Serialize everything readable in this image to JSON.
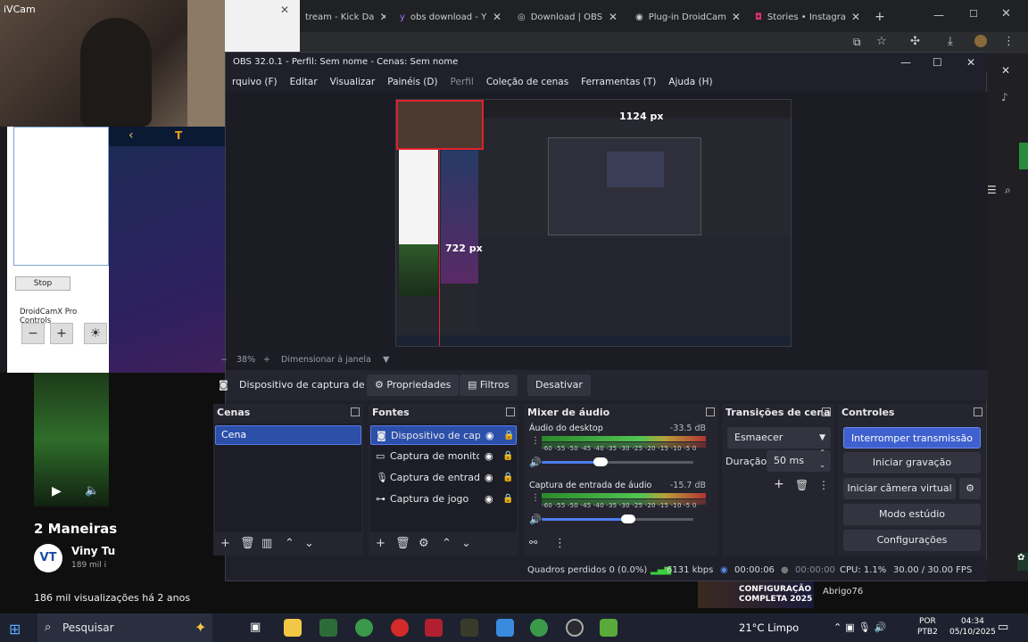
{
  "webcam": {
    "title": "iVCam"
  },
  "browser": {
    "tabs": [
      {
        "label": "tream - Kick Da"
      },
      {
        "label": "obs download - Y"
      },
      {
        "label": "Download | OBS"
      },
      {
        "label": "Plug-in DroidCam"
      },
      {
        "label": "Stories • Instagra"
      }
    ],
    "new_tab": "+"
  },
  "droidcam": {
    "stop_label": "Stop",
    "controls_label": "DroidCamX Pro Controls"
  },
  "youtube": {
    "video_title": "2 Maneiras",
    "channel": "Viny Tu",
    "avatar_text": "VT",
    "subs": "189 mil i",
    "views": "186 mil visualizações há 2 anos",
    "comment_author": "Abrigo76",
    "promo": "CONFIGURAÇÃO COMPLETA 2025"
  },
  "obs": {
    "title": "OBS 32.0.1 - Perfil: Sem nome - Cenas: Sem nome",
    "menu": [
      "rquivo (F)",
      "Editar",
      "Visualizar",
      "Painéis (D)",
      "Perfil",
      "Coleção de cenas",
      "Ferramentas (T)",
      "Ajuda (H)"
    ],
    "preview": {
      "width_label": "1124 px",
      "height_label": "722 px"
    },
    "zoom": {
      "minus": "−",
      "value": "38%",
      "plus": "+",
      "fit": "Dimensionar à janela"
    },
    "source_toolbar": {
      "source_name": "Dispositivo de captura de v",
      "properties": "Propriedades",
      "filters": "Filtros",
      "deactivate": "Desativar"
    },
    "scenes": {
      "title": "Cenas",
      "items": [
        "Cena"
      ]
    },
    "sources": {
      "title": "Fontes",
      "items": [
        {
          "label": "Dispositivo de captu",
          "icon": "camera-icon"
        },
        {
          "label": "Captura de monitor",
          "icon": "monitor-icon"
        },
        {
          "label": "Captura de entrada",
          "icon": "microphone-icon"
        },
        {
          "label": "Captura de jogo",
          "icon": "gamepad-icon"
        }
      ]
    },
    "mixer": {
      "title": "Mixer de áudio",
      "channels": [
        {
          "name": "Áudio do desktop",
          "db": "-33.5 dB",
          "volume": 0.39
        },
        {
          "name": "Captura de entrada de áudio",
          "db": "-15.7 dB",
          "volume": 0.57
        }
      ],
      "scale": "-60 -55 -50 -45 -40 -35 -30 -25 -20 -15 -10 -5 0"
    },
    "transitions": {
      "title": "Transições de cena",
      "selected": "Esmaecer",
      "duration_label": "Duração",
      "duration_value": "50 ms"
    },
    "controls": {
      "title": "Controles",
      "buttons": [
        "Interromper transmissão",
        "Iniciar gravação",
        "Iniciar câmera virtual",
        "Modo estúdio",
        "Configurações"
      ]
    },
    "status": {
      "dropped": "Quadros perdidos 0 (0.0%)",
      "bitrate": "6131 kbps",
      "stream_time": "00:00:06",
      "rec_time": "00:00:00",
      "cpu": "CPU: 1.1%",
      "fps": "30.00 / 30.00 FPS"
    }
  },
  "taskbar": {
    "search": "Pesquisar",
    "weather": "21°C  Limpo",
    "lang1": "POR",
    "lang2": "PTB2",
    "time": "04:34",
    "date": "05/10/2025"
  },
  "colors": {
    "accent": "#3f61cf",
    "meter_green": "#52c552",
    "obs_bg": "#1f2029",
    "selection_red": "#e0212b"
  }
}
